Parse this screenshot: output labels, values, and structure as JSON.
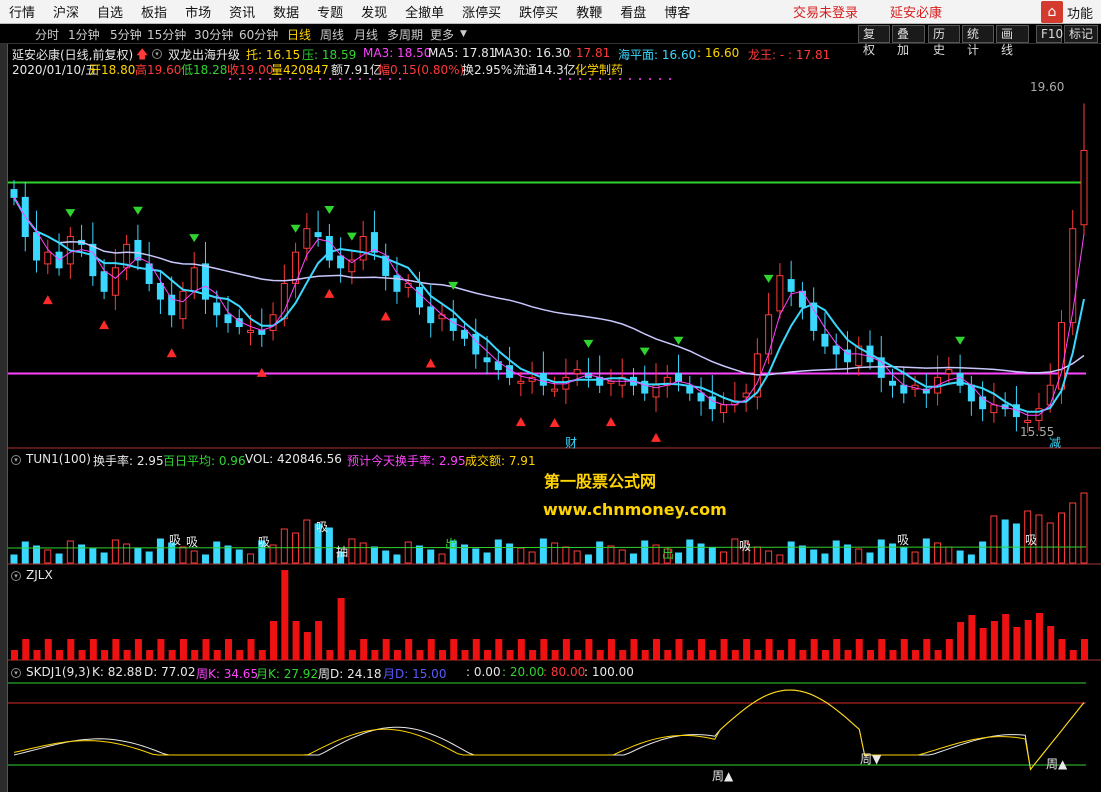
{
  "menubar": {
    "items": [
      "行情",
      "沪深",
      "自选",
      "板指",
      "市场",
      "资讯",
      "数据",
      "专题",
      "发现",
      "全撤单",
      "涨停买",
      "跌停买",
      "教鞭",
      "看盘",
      "博客"
    ],
    "login_status": "交易未登录",
    "stock_name": "延安必康",
    "func_icon": "home-icon",
    "func_label": "功能"
  },
  "periodbar": {
    "periods": [
      "分时",
      "1分钟",
      "5分钟",
      "15分钟",
      "30分钟",
      "60分钟",
      "日线",
      "周线",
      "月线",
      "多周期",
      "更多"
    ],
    "active": "日线",
    "tools": [
      "复权",
      "叠加",
      "历史",
      "统计",
      "画线",
      "F10",
      "标记"
    ]
  },
  "header": {
    "title": "延安必康(日线,前复权)",
    "indicator_name": "双龙出海升级",
    "tuo": "托: 16.15",
    "ya": "压: 18.59",
    "ma3": "MA3: 18.50",
    "ma5": "MA5: 17.81",
    "ma30": "MA30: 16.30",
    "ma_extra": ": 17.81",
    "haipingmian": "海平面: 16.60",
    "extra": ": 16.60",
    "longwang": "龙王: - : 17.81",
    "date": "2020/01/10/五",
    "open": "开18.80",
    "high": "高19.60",
    "low": "低18.28",
    "close": "收19.00",
    "volume": "量420847",
    "amount": "额7.91亿",
    "change": "幅0.15(0.80%)",
    "turnover": "换2.95%",
    "float_mv": "流通14.3亿",
    "sector": "化学制药"
  },
  "annotations": {
    "high_label": "19.60",
    "low_label": "15.55",
    "cai": "财",
    "jian": "减",
    "zhou": "周",
    "xi": "吸",
    "chu": "出",
    "chou": "抽"
  },
  "turnover_panel": {
    "title": "TUN1(100)",
    "rate": "换手率: 2.95",
    "avg": "百日平均: 0.96",
    "vol": "VOL: 420846.56",
    "forecast": "预计今天换手率: 2.95",
    "amount": "成交额: 7.91"
  },
  "zjlx_panel": {
    "title": "ZJLX"
  },
  "skdj_panel": {
    "title": "SKDJ1(9,3)",
    "k": "K: 82.88",
    "d": "D: 77.02",
    "week_k": "周K: 34.65",
    "month_k": "月K: 27.92",
    "week_d": "周D: 24.18",
    "month_d": "月D: 15.00",
    "lv0": ": 0.00",
    "lv20": ": 20.00",
    "lv80": ": 80.00",
    "lv100": ": 100.00"
  },
  "watermark": {
    "line1": "第一股票公式网",
    "line2": "www.chnmoney.com"
  },
  "chart_data": {
    "type": "candlestick",
    "price_axis_label": "19.60",
    "hlines": {
      "green": 18.59,
      "magenta": 16.15
    },
    "closes": [
      18.4,
      17.9,
      17.6,
      17.7,
      17.5,
      17.9,
      17.8,
      17.4,
      17.2,
      17.5,
      17.8,
      17.6,
      17.3,
      17.1,
      16.9,
      17.2,
      17.5,
      17.1,
      16.9,
      16.8,
      16.75,
      16.7,
      16.65,
      16.9,
      17.3,
      17.7,
      18.0,
      17.9,
      17.6,
      17.5,
      17.6,
      17.9,
      17.7,
      17.4,
      17.2,
      17.3,
      17.0,
      16.8,
      16.9,
      16.7,
      16.6,
      16.4,
      16.3,
      16.2,
      16.1,
      16.05,
      16.1,
      16.0,
      15.95,
      16.1,
      16.2,
      16.1,
      16.0,
      16.05,
      16.1,
      16.0,
      15.9,
      16.0,
      16.1,
      16.05,
      15.9,
      15.8,
      15.7,
      15.75,
      15.8,
      15.9,
      16.4,
      16.9,
      17.4,
      17.2,
      17.0,
      16.7,
      16.5,
      16.4,
      16.3,
      16.5,
      16.3,
      16.1,
      16.0,
      15.9,
      16.0,
      15.9,
      16.1,
      16.2,
      16.0,
      15.8,
      15.7,
      15.75,
      15.7,
      15.6,
      15.55,
      15.7,
      16.0,
      16.8,
      18.0,
      19.0
    ]
  }
}
